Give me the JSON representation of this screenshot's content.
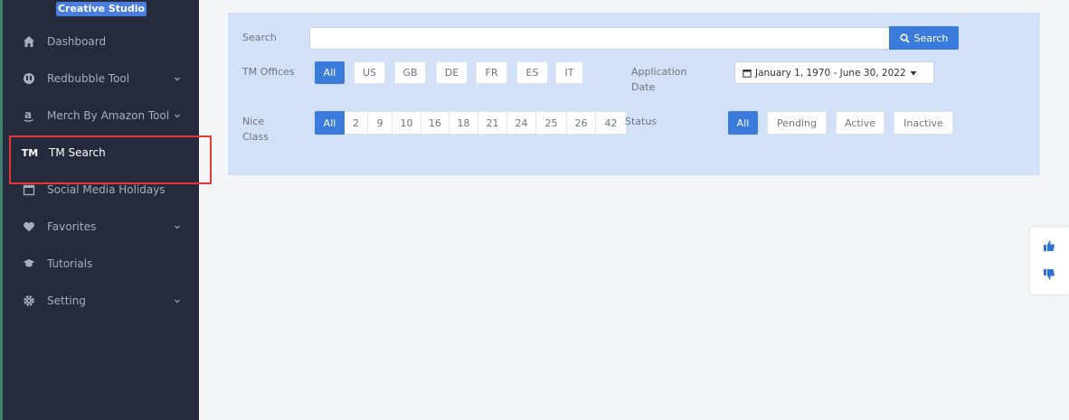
{
  "sidebar": {
    "brand": "Creative Studio",
    "items": [
      {
        "label": "Dashboard",
        "icon": "home-icon",
        "has_children": false
      },
      {
        "label": "Redbubble Tool",
        "icon": "redbubble-icon",
        "has_children": true
      },
      {
        "label": "Merch By Amazon Tool",
        "icon": "amazon-icon",
        "has_children": true
      },
      {
        "label": "TM Search",
        "icon": "tm-icon",
        "icon_text": "TM",
        "has_children": false,
        "active": true
      },
      {
        "label": "Social Media Holidays",
        "icon": "calendar-icon",
        "has_children": false
      },
      {
        "label": "Favorites",
        "icon": "heart-icon",
        "has_children": true
      },
      {
        "label": "Tutorials",
        "icon": "graduation-cap-icon",
        "has_children": false
      },
      {
        "label": "Setting",
        "icon": "gear-icon",
        "has_children": true
      }
    ]
  },
  "filters": {
    "search_label": "Search",
    "search_value": "",
    "search_button": "Search",
    "offices_label": "TM Offices",
    "offices": [
      "All",
      "US",
      "GB",
      "DE",
      "FR",
      "ES",
      "IT"
    ],
    "offices_selected": "All",
    "date_label": "Application Date",
    "date_range": "January 1, 1970 - June 30, 2022",
    "class_label": "Nice Class",
    "classes": [
      "All",
      "2",
      "9",
      "10",
      "16",
      "18",
      "21",
      "24",
      "25",
      "26",
      "42"
    ],
    "class_selected": "All",
    "status_label": "Status",
    "statuses": [
      "All",
      "Pending",
      "Active",
      "Inactive"
    ],
    "status_selected": "All"
  },
  "colors": {
    "sidebar_bg": "#252b3d",
    "accent": "#3a7bdc",
    "panel_bg": "#d2e1f7",
    "highlight": "#e53935"
  },
  "feedback": {
    "up_icon": "thumbs-up-icon",
    "down_icon": "thumbs-down-icon"
  }
}
